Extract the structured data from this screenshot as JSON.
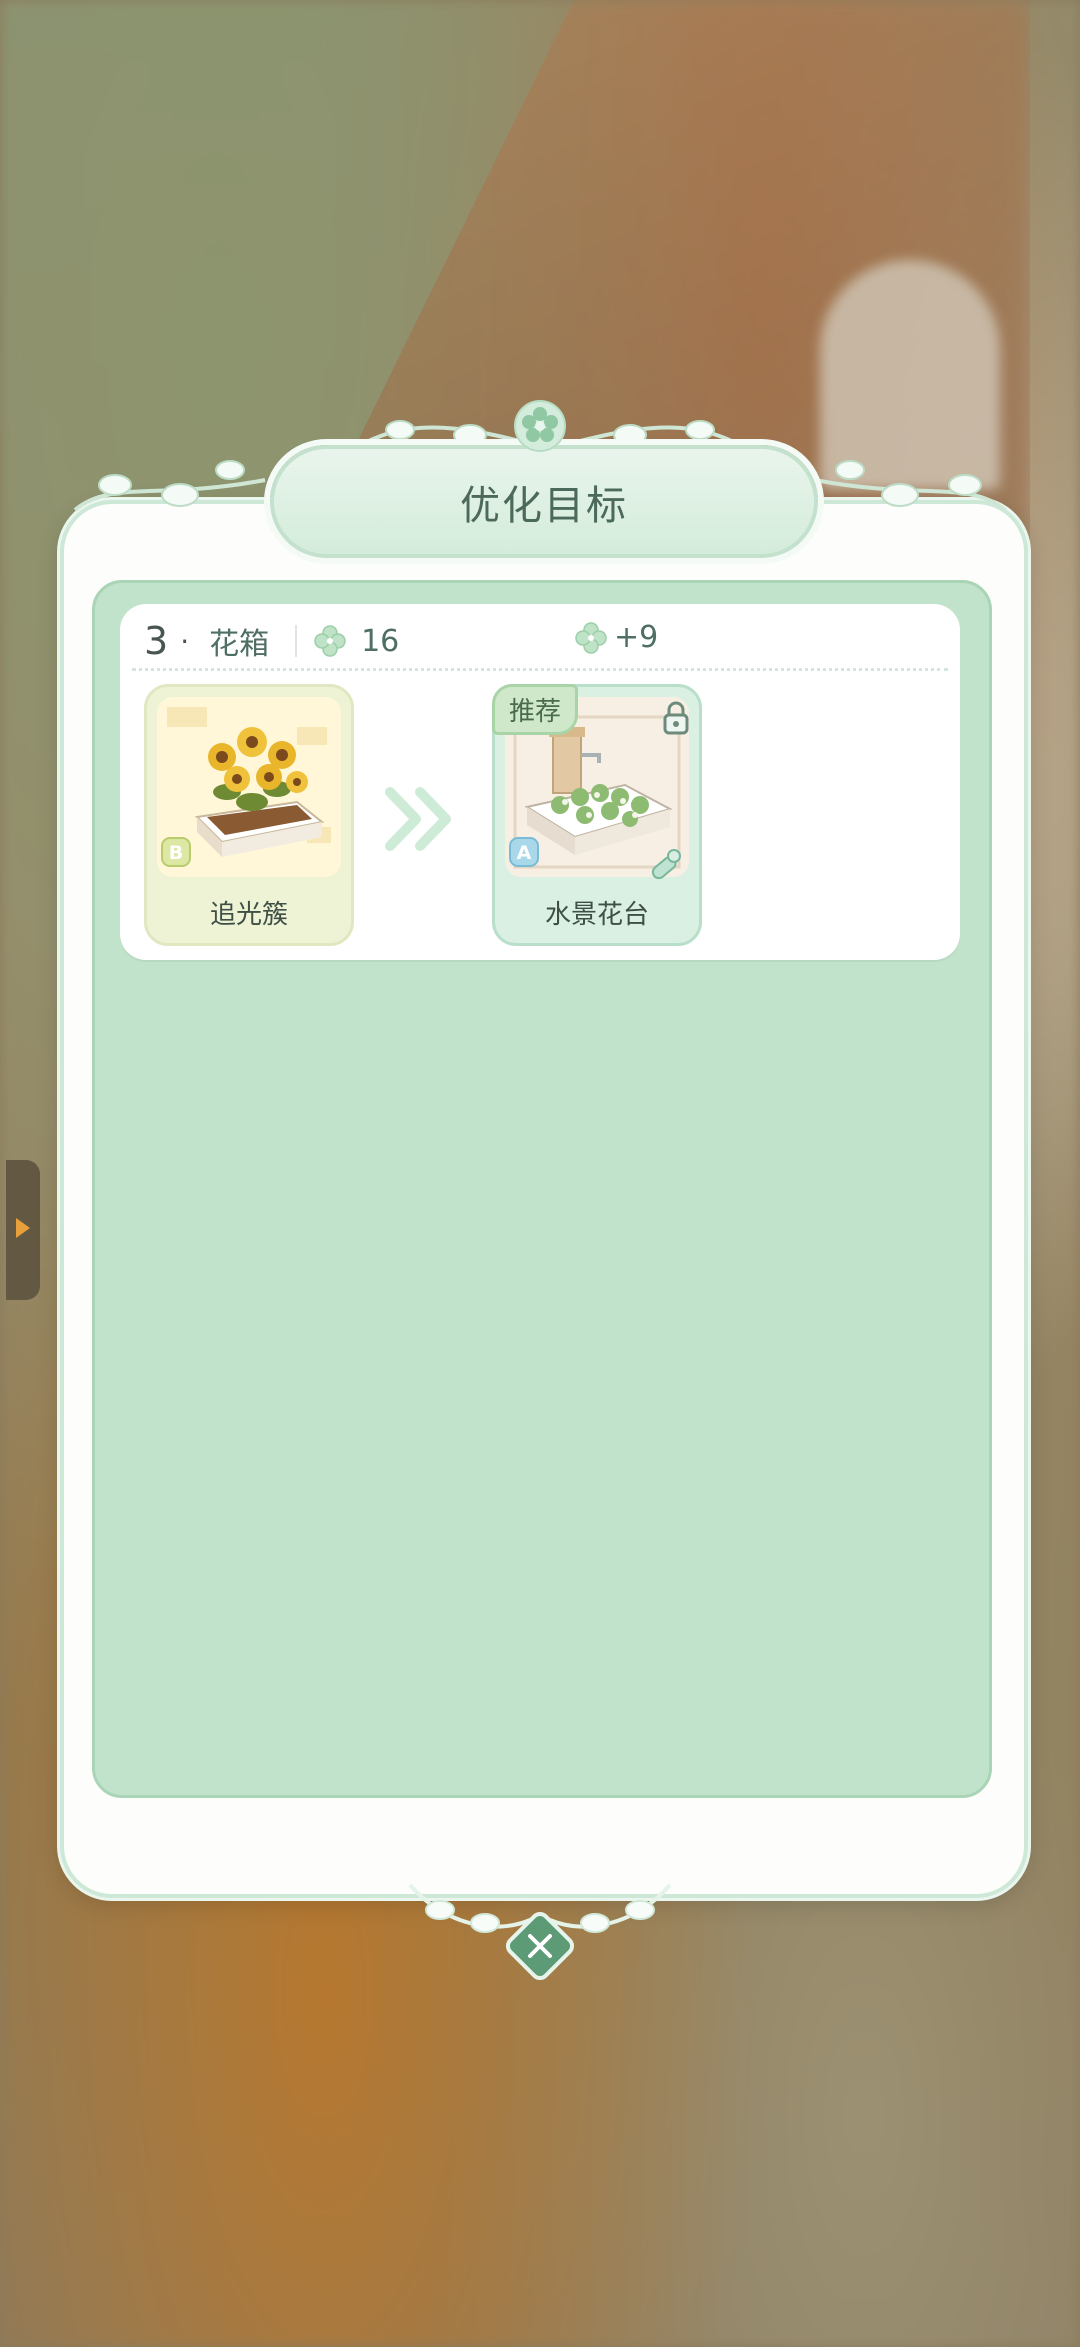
{
  "title": "优化目标",
  "colors": {
    "panel_border": "#cde8d6",
    "inner_bg": "#c1e3cb",
    "accent": "#6bb083",
    "close_btn": "#5d9a76"
  },
  "entry": {
    "rank": "3",
    "dot": "·",
    "category": "花箱",
    "score": "16",
    "bonus": "+9",
    "icon": "clover-icon"
  },
  "current_item": {
    "name": "追光簇",
    "grade": "B"
  },
  "target_item": {
    "name": "水景花台",
    "grade": "A",
    "badge": "推荐",
    "locked": true
  },
  "close_icon": "close-icon"
}
